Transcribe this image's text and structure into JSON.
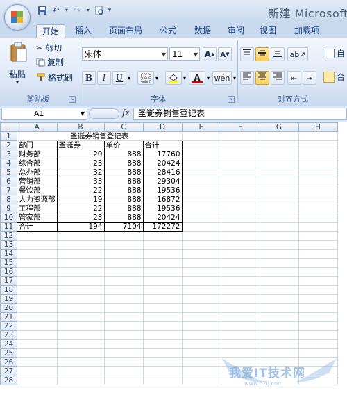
{
  "window": {
    "title": "新建 Microsoft"
  },
  "tabs": [
    "开始",
    "插入",
    "页面布局",
    "公式",
    "数据",
    "审阅",
    "视图",
    "加载项"
  ],
  "ribbon": {
    "clipboard": {
      "paste_label": "粘贴",
      "cut_label": "剪切",
      "copy_label": "复制",
      "format_painter_label": "格式刷",
      "group_label": "剪贴板"
    },
    "font": {
      "font_name": "宋体",
      "font_size": "11",
      "bold": "B",
      "italic": "I",
      "underline": "U",
      "font_color_glyph": "A",
      "group_label": "字体"
    },
    "alignment": {
      "group_label": "对齐方式",
      "wrap_label": "自",
      "merge_label": "合"
    }
  },
  "formula_bar": {
    "name_box": "A1",
    "fx_label": "fx",
    "content": "圣诞券销售登记表"
  },
  "sheet": {
    "columns": [
      "A",
      "B",
      "C",
      "D",
      "E",
      "F",
      "G",
      "H"
    ],
    "rows": [
      [
        "",
        "圣诞券销售登记表",
        "",
        "",
        "",
        "",
        "",
        ""
      ],
      [
        "部门",
        "圣诞券",
        "单价",
        "合计",
        "",
        "",
        "",
        ""
      ],
      [
        "财务部",
        "20",
        "888",
        "17760",
        "",
        "",
        "",
        ""
      ],
      [
        "综合部",
        "23",
        "888",
        "20424",
        "",
        "",
        "",
        ""
      ],
      [
        "总办部",
        "32",
        "888",
        "28416",
        "",
        "",
        "",
        ""
      ],
      [
        "营销部",
        "33",
        "888",
        "29304",
        "",
        "",
        "",
        ""
      ],
      [
        "餐饮部",
        "22",
        "888",
        "19536",
        "",
        "",
        "",
        ""
      ],
      [
        "人力资源部",
        "19",
        "888",
        "16872",
        "",
        "",
        "",
        ""
      ],
      [
        "工程部",
        "22",
        "888",
        "19536",
        "",
        "",
        "",
        ""
      ],
      [
        "管家部",
        "23",
        "888",
        "20424",
        "",
        "",
        "",
        ""
      ],
      [
        "合计",
        "194",
        "7104",
        "172272",
        "",
        "",
        "",
        ""
      ]
    ],
    "row_count": 28
  },
  "watermark": {
    "text": "我爱IT技术网",
    "url": "www.52ij.com"
  },
  "colors": {
    "accent": "#15428b",
    "ribbon_bg": "#dbe6f5",
    "grid_line": "#d0d7e5"
  }
}
